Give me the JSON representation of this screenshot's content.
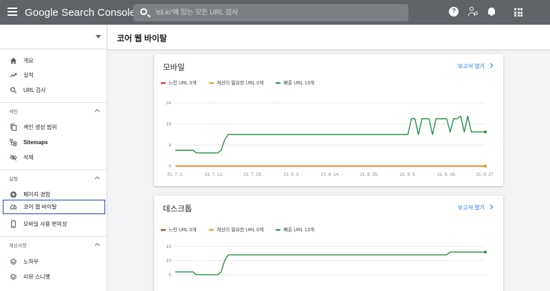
{
  "topbar": {
    "brand": "Google Search Console",
    "search_placeholder": "'eli.kr'에 있는 모든 URL 검사",
    "help_glyph": "?"
  },
  "sidebar": {
    "items_top": [
      {
        "label": "개요",
        "icon": "home-icon"
      },
      {
        "label": "실적",
        "icon": "trending-up-icon"
      },
      {
        "label": "URL 검사",
        "icon": "search-icon"
      }
    ],
    "sections": [
      {
        "label": "색인",
        "items": [
          {
            "label": "색인 생성 범위",
            "icon": "copy-icon"
          },
          {
            "label": "Sitemaps",
            "icon": "sitemap-icon"
          },
          {
            "label": "삭제",
            "icon": "eye-off-icon"
          }
        ]
      },
      {
        "label": "실험",
        "items": [
          {
            "label": "페이지 경험",
            "icon": "plus-circle-icon"
          },
          {
            "label": "코어 웹 바이탈",
            "icon": "speed-gauge-icon"
          },
          {
            "label": "모바일 사용 편의성",
            "icon": "phone-icon"
          }
        ]
      },
      {
        "label": "개선사항",
        "items": [
          {
            "label": "노하우",
            "icon": "layers-icon"
          },
          {
            "label": "리뷰 스니펫",
            "icon": "layers-icon"
          }
        ]
      }
    ],
    "active_item": "코어 웹 바이탈",
    "active_border_color": "#1a3eb8"
  },
  "header": {
    "title": "코어 웹 바이탈"
  },
  "colors": {
    "poor": "#c5221f",
    "needs_improvement": "#f29900",
    "good": "#1e8e3e",
    "link": "#1a73e8"
  },
  "cards": [
    {
      "title": "모바일",
      "open_report": "보고서 열기",
      "legend": [
        "느린 URL 0개",
        "개선이 필요한 URL 0개",
        "빠른 URL 13개"
      ]
    },
    {
      "title": "데스크톱",
      "open_report": "보고서 열기",
      "legend": [
        "느린 URL 0개",
        "개선이 필요한 URL 0개",
        "빠른 URL 13개"
      ]
    }
  ],
  "chart_data": [
    {
      "type": "line",
      "title": "모바일",
      "ylim": [
        0,
        24
      ],
      "yticks": [
        "24",
        "16",
        "8",
        "0"
      ],
      "xticks": [
        "21. 7. 1.",
        "21. 7. 12.",
        "21. 7. 23.",
        "21. 8. 3.",
        "21. 8. 14.",
        "21. 8. 25.",
        "21. 9. 5.",
        "21. 9. 16.",
        "21. 9. 27."
      ],
      "x": [
        1,
        2,
        3,
        4,
        5,
        6,
        7,
        8,
        9,
        10,
        11,
        12,
        13,
        14,
        15,
        16,
        17,
        18,
        19,
        20,
        21,
        22,
        23,
        24,
        25,
        26,
        27,
        28,
        29,
        30,
        31,
        32,
        33,
        34,
        35,
        36,
        37,
        38,
        39,
        40,
        41,
        42,
        43,
        44,
        45,
        46,
        47,
        48,
        49,
        50,
        51,
        52,
        53,
        54,
        55,
        56,
        57,
        58,
        59,
        60,
        61,
        62,
        63,
        64,
        65,
        66,
        67,
        68,
        69,
        70,
        71,
        72,
        73,
        74,
        75,
        76,
        77,
        78,
        79,
        80,
        81,
        82,
        83,
        84,
        85,
        86,
        87,
        88,
        89
      ],
      "series": [
        {
          "name": "느린 URL 0개",
          "values": [
            0,
            0,
            0,
            0,
            0,
            0,
            0,
            0,
            0,
            0,
            0,
            0,
            0,
            0,
            0,
            0,
            0,
            0,
            0,
            0,
            0,
            0,
            0,
            0,
            0,
            0,
            0,
            0,
            0,
            0,
            0,
            0,
            0,
            0,
            0,
            0,
            0,
            0,
            0,
            0,
            0,
            0,
            0,
            0,
            0,
            0,
            0,
            0,
            0,
            0,
            0,
            0,
            0,
            0,
            0,
            0,
            0,
            0,
            0,
            0,
            0,
            0,
            0,
            0,
            0,
            0,
            0,
            0,
            0,
            0,
            0,
            0,
            0,
            0,
            0,
            0,
            0,
            0,
            0,
            0,
            0,
            0,
            0,
            0,
            0,
            0,
            0,
            0,
            0
          ]
        },
        {
          "name": "개선이 필요한 URL 0개",
          "values": [
            0,
            0,
            0,
            0,
            0,
            0,
            0,
            0,
            0,
            0,
            0,
            0,
            0,
            0,
            0,
            0,
            0,
            0,
            0,
            0,
            0,
            0,
            0,
            0,
            0,
            0,
            0,
            0,
            0,
            0,
            0,
            0,
            0,
            0,
            0,
            0,
            0,
            0,
            0,
            0,
            0,
            0,
            0,
            0,
            0,
            0,
            0,
            0,
            0,
            0,
            0,
            0,
            0,
            0,
            0,
            0,
            0,
            0,
            0,
            0,
            0,
            0,
            0,
            0,
            0,
            0,
            0,
            0,
            0,
            0,
            0,
            0,
            0,
            0,
            0,
            0,
            0,
            0,
            0,
            0,
            0,
            0,
            0,
            0,
            0,
            0,
            0,
            0,
            0
          ]
        },
        {
          "name": "빠른 URL 13개",
          "values": [
            6,
            6,
            6,
            6,
            6,
            6,
            5,
            5,
            5,
            5,
            5,
            5,
            5,
            6,
            10,
            12,
            12,
            12,
            12,
            12,
            12,
            12,
            12,
            12,
            12,
            12,
            12,
            12,
            12,
            12,
            12,
            12,
            12,
            12,
            12,
            12,
            12,
            12,
            12,
            12,
            12,
            12,
            12,
            12,
            12,
            12,
            12,
            12,
            12,
            12,
            12,
            12,
            12,
            12,
            12,
            12,
            12,
            12,
            12,
            12,
            12,
            12,
            12,
            12,
            12,
            12,
            12,
            18,
            18,
            12,
            18,
            18,
            18,
            12,
            18,
            18,
            18,
            18,
            13,
            18,
            18,
            19,
            13,
            19,
            13,
            13,
            13,
            13,
            13
          ]
        }
      ]
    },
    {
      "type": "line",
      "title": "데스크톱",
      "ylim": [
        0,
        15
      ],
      "yticks": [
        "15",
        "10",
        "5"
      ],
      "xticks": [],
      "x": [
        1,
        2,
        3,
        4,
        5,
        6,
        7,
        8,
        9,
        10,
        11,
        12,
        13,
        14,
        15,
        16,
        17,
        18,
        19,
        20,
        21,
        22,
        23,
        24,
        25,
        26,
        27,
        28,
        29,
        30,
        31,
        32,
        33,
        34,
        35,
        36,
        37,
        38,
        39,
        40,
        41,
        42,
        43,
        44,
        45,
        46,
        47,
        48,
        49,
        50,
        51,
        52,
        53,
        54,
        55,
        56,
        57,
        58,
        59,
        60,
        61,
        62,
        63,
        64,
        65,
        66,
        67,
        68,
        69,
        70,
        71,
        72,
        73,
        74,
        75,
        76,
        77,
        78,
        79,
        80,
        81,
        82,
        83,
        84,
        85,
        86,
        87,
        88,
        89
      ],
      "series": [
        {
          "name": "빠른 URL 13개",
          "values": [
            6,
            6,
            6,
            6,
            6,
            6,
            5,
            5,
            5,
            5,
            5,
            5,
            5,
            6,
            10,
            12,
            12,
            12,
            12,
            12,
            12,
            12,
            12,
            12,
            12,
            12,
            12,
            12,
            12,
            12,
            12,
            12,
            12,
            12,
            12,
            12,
            12,
            12,
            12,
            12,
            12,
            12,
            12,
            12,
            12,
            12,
            12,
            12,
            12,
            12,
            12,
            12,
            12,
            12,
            12,
            12,
            12,
            12,
            12,
            12,
            12,
            12,
            12,
            12,
            12,
            12,
            12,
            12,
            12,
            12,
            12,
            12,
            12,
            12,
            12,
            12,
            12,
            12,
            13,
            13,
            13,
            13,
            13,
            13,
            13,
            13,
            13,
            13,
            13
          ]
        }
      ]
    }
  ]
}
